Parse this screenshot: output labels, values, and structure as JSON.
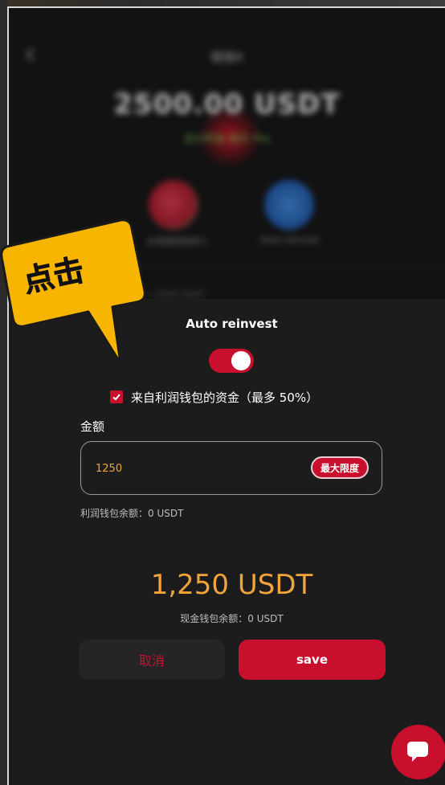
{
  "background_page": {
    "back_icon": "chevron-left-icon",
    "title": "链接A",
    "amount": "2500.00 USDT",
    "subtext": "总计积极 额外 Pro",
    "feature_left_label": "从现金钱包转入",
    "feature_right_label": "Auto reinvest",
    "row_label": "+ 2500 USDT"
  },
  "modal": {
    "title": "Auto reinvest",
    "toggle_on": true,
    "checkbox_checked": true,
    "checkbox_label": "来自利润钱包的资金（最多 50%）",
    "amount_label": "金额",
    "amount_value": "1250",
    "max_button": "最大限度",
    "profit_balance": "利润钱包余额：0 USDT",
    "total": "1,250 USDT",
    "cash_balance": "现金钱包余额：0 USDT",
    "cancel_label": "取消",
    "save_label": "save"
  },
  "callout": {
    "text": "点击",
    "color": "#f7b500"
  },
  "chat": {
    "icon": "chat-bubble-icon"
  },
  "colors": {
    "accent": "#c8102e",
    "amount": "#f2a33a",
    "background": "#1c1c1c"
  }
}
